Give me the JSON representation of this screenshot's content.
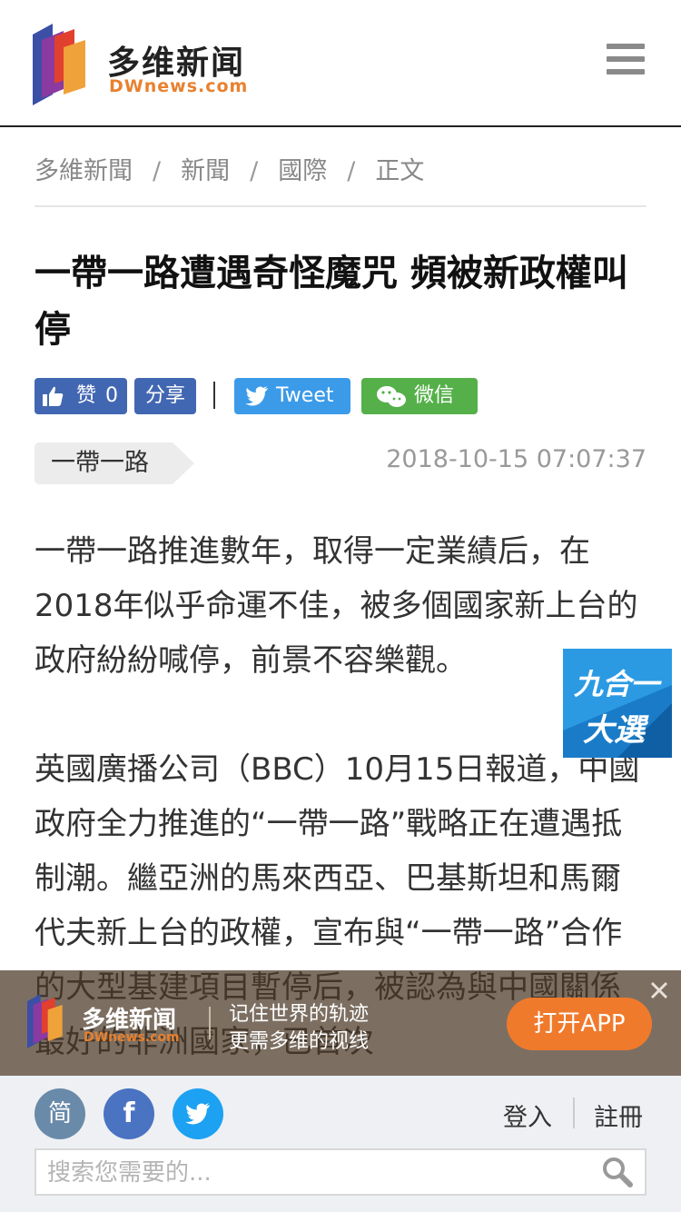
{
  "header": {
    "logo_cn": "多维新闻",
    "logo_en": "DWnews.com"
  },
  "breadcrumb": [
    "多維新聞",
    "新聞",
    "國際",
    "正文"
  ],
  "article": {
    "title": "一帶一路遭遇奇怪魔咒 頻被新政權叫停",
    "tag": "一帶一路",
    "date": "2018-10-15 07:07:37",
    "paragraphs": [
      "一帶一路推進數年，取得一定業績后，在2018年似乎命運不佳，被多個國家新上台的政府紛紛喊停，前景不容樂觀。",
      "英國廣播公司（BBC）10月15日報道，中國政府全力推進的“一帶一路”戰略正在遭遇抵制潮。繼亞洲的馬來西亞、巴基斯坦和馬爾代夫新上台的政權，宣布與“一帶一路”合作的大型基建項目暫停后，被認為與中國關係最好的非洲國家，已首次"
    ]
  },
  "share": {
    "like_label": "赞",
    "like_count": "0",
    "share_label": "分享",
    "tweet_label": "Tweet",
    "wechat_label": "微信"
  },
  "float_badge": {
    "line1": "九合一",
    "line2": "大選"
  },
  "app_banner": {
    "logo_cn": "多维新闻",
    "logo_en": "DWnews.com",
    "line1": "记住世界的轨迹",
    "line2": "更需多维的视线",
    "open_label": "打开APP"
  },
  "footer": {
    "simplified_label": "简",
    "facebook_label": "f",
    "login_label": "登入",
    "register_label": "註冊",
    "search_placeholder": "搜索您需要的..."
  },
  "colors": {
    "facebook_blue": "#4267b2",
    "twitter_blue": "#3c9be8",
    "wechat_green": "#55b04a",
    "accent_orange": "#f07a2c"
  }
}
